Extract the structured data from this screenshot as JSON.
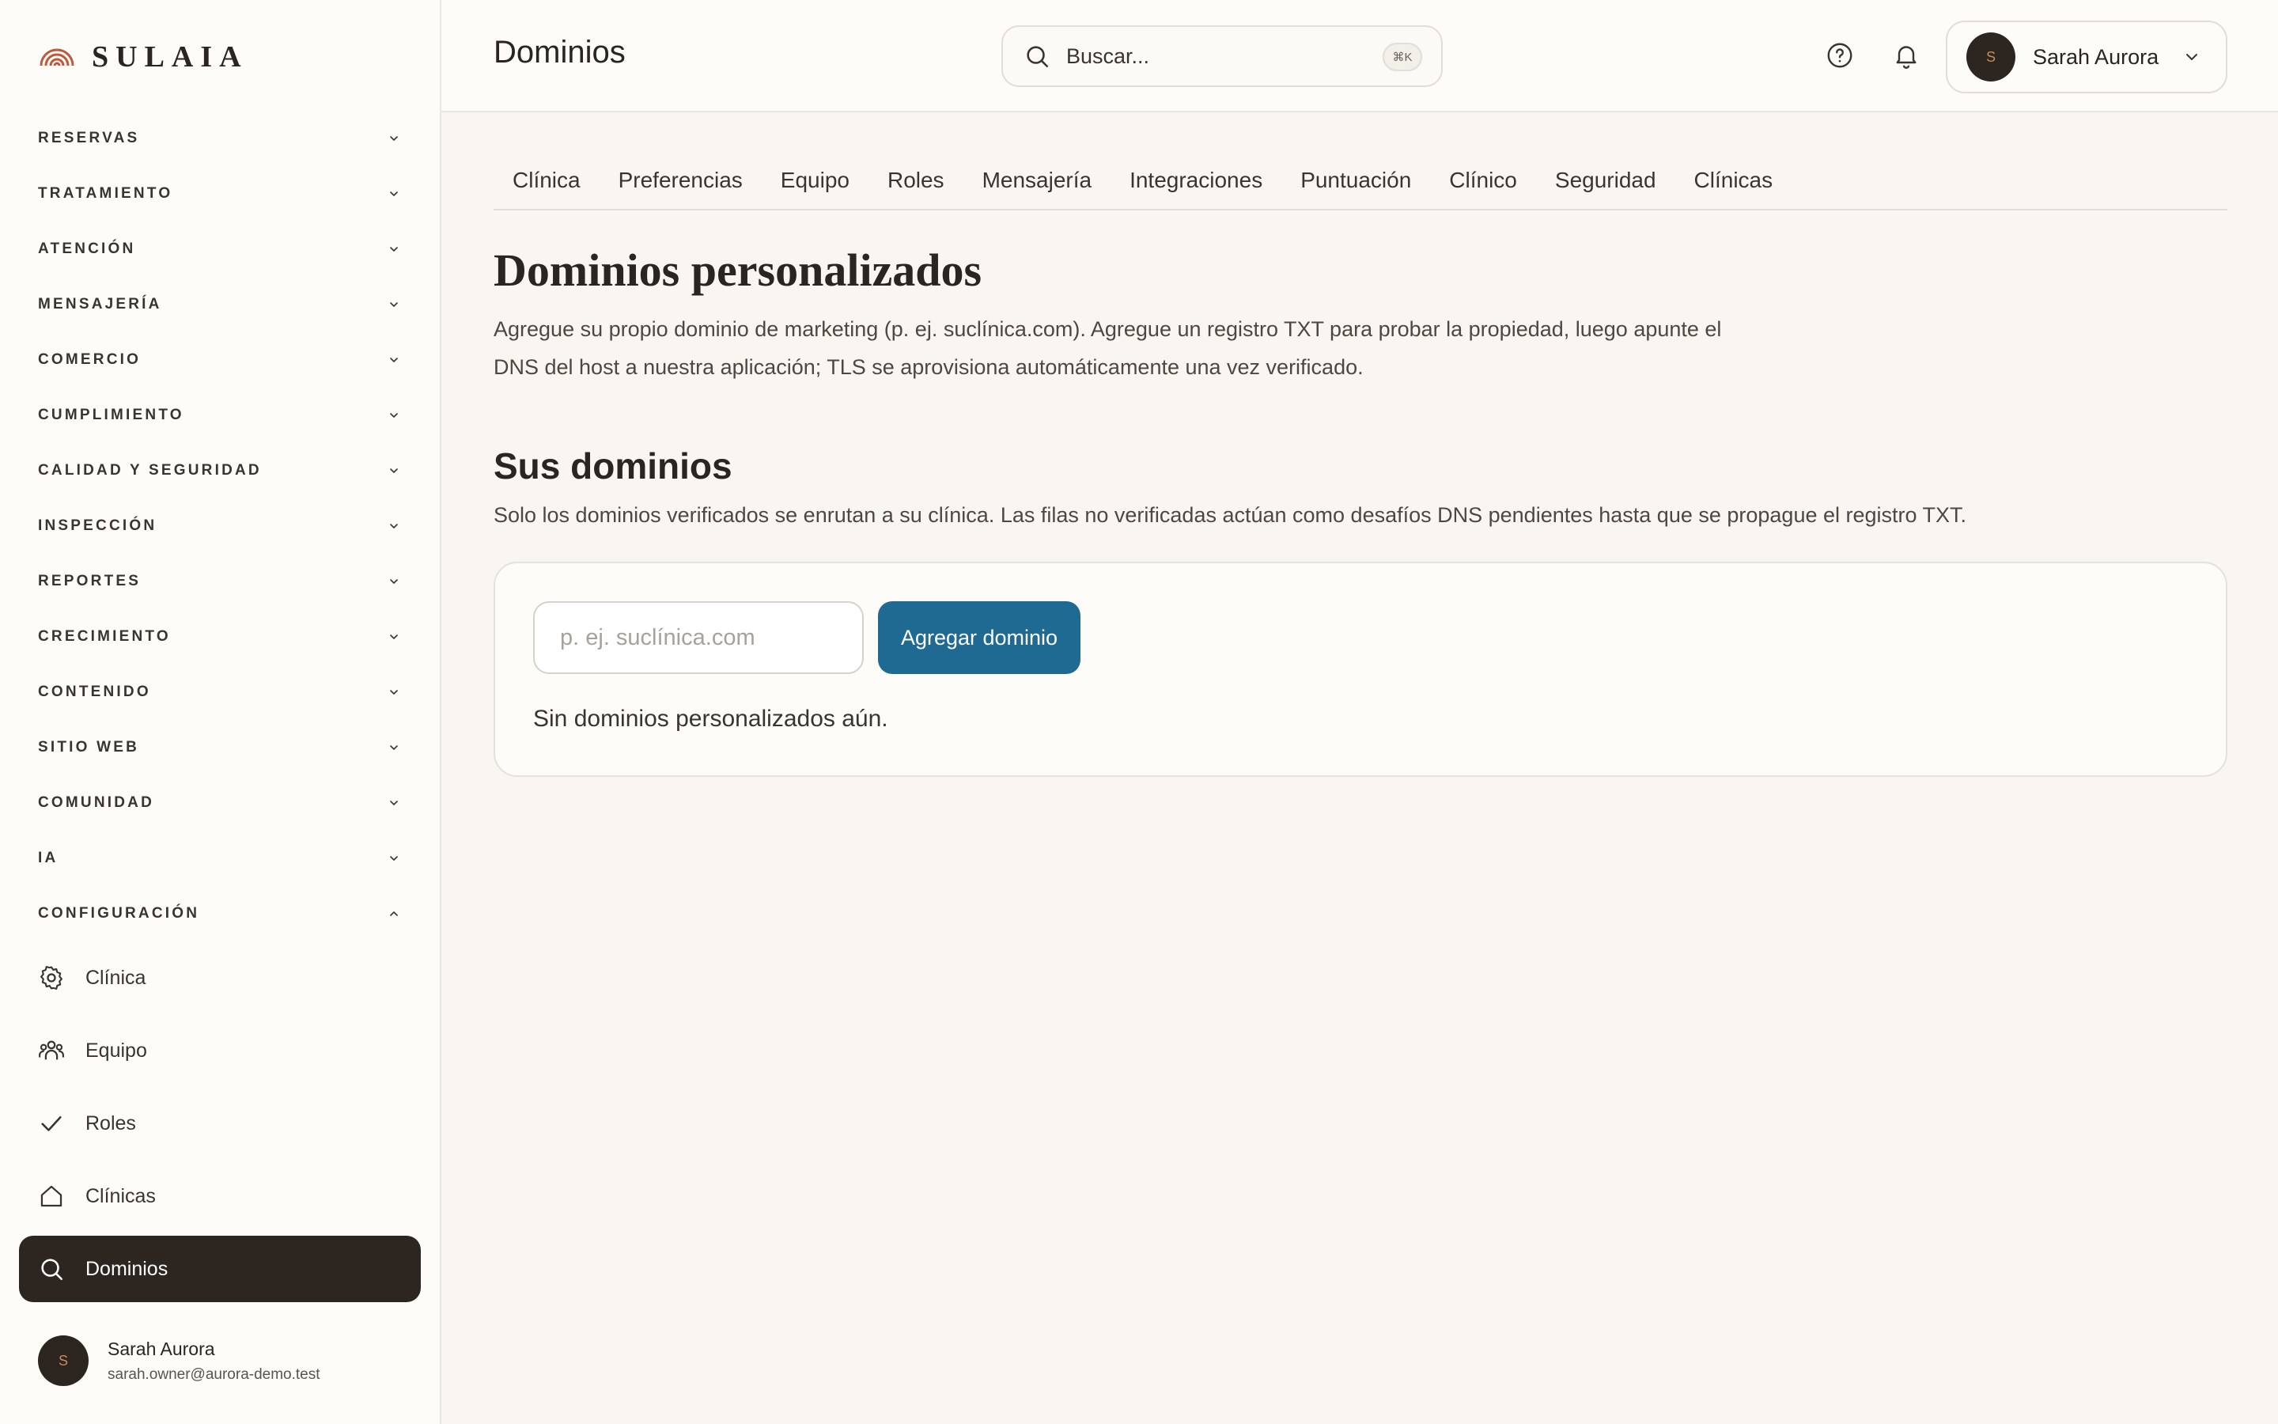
{
  "brand": {
    "name": "SULAIA",
    "logo_icon": "rainbow-arch-logo",
    "accent": "#c0593a"
  },
  "sidebar": {
    "sections": [
      {
        "label": "RESERVAS",
        "expanded": false
      },
      {
        "label": "TRATAMIENTO",
        "expanded": false
      },
      {
        "label": "ATENCIÓN",
        "expanded": false
      },
      {
        "label": "MENSAJERÍA",
        "expanded": false
      },
      {
        "label": "COMERCIO",
        "expanded": false
      },
      {
        "label": "CUMPLIMIENTO",
        "expanded": false
      },
      {
        "label": "CALIDAD Y SEGURIDAD",
        "expanded": false
      },
      {
        "label": "INSPECCIÓN",
        "expanded": false
      },
      {
        "label": "REPORTES",
        "expanded": false
      },
      {
        "label": "CRECIMIENTO",
        "expanded": false
      },
      {
        "label": "CONTENIDO",
        "expanded": false
      },
      {
        "label": "SITIO WEB",
        "expanded": false
      },
      {
        "label": "COMUNIDAD",
        "expanded": false
      },
      {
        "label": "IA",
        "expanded": false
      },
      {
        "label": "CONFIGURACIÓN",
        "expanded": true
      }
    ],
    "config_items": [
      {
        "label": "Clínica",
        "icon": "gear-icon"
      },
      {
        "label": "Equipo",
        "icon": "team-icon"
      },
      {
        "label": "Roles",
        "icon": "check-icon"
      },
      {
        "label": "Clínicas",
        "icon": "home-icon"
      },
      {
        "label": "Dominios",
        "icon": "search-icon",
        "active": true
      }
    ],
    "user": {
      "name": "Sarah Aurora",
      "email": "sarah.owner@aurora-demo.test",
      "initial": "S"
    }
  },
  "header": {
    "title": "Dominios",
    "search": {
      "placeholder": "Buscar...",
      "shortcut": "⌘K"
    },
    "help_icon": "help-circle-icon",
    "bell_icon": "bell-icon",
    "user": {
      "name": "Sarah Aurora",
      "initial": "S"
    }
  },
  "tabs": [
    "Clínica",
    "Preferencias",
    "Equipo",
    "Roles",
    "Mensajería",
    "Integraciones",
    "Puntuación",
    "Clínico",
    "Seguridad",
    "Clínicas"
  ],
  "main": {
    "heading": "Dominios personalizados",
    "description": "Agregue su propio dominio de marketing (p. ej. suclínica.com). Agregue un registro TXT para probar la propiedad, luego apunte el DNS del host a nuestra aplicación; TLS se aprovisiona automáticamente una vez verificado.",
    "subheading": "Sus dominios",
    "subdescription": "Solo los dominios verificados se enrutan a su clínica. Las filas no verificadas actúan como desafíos DNS pendientes hasta que se propague el registro TXT.",
    "input_placeholder": "p. ej. suclínica.com",
    "input_value": "",
    "add_button": "Agregar dominio",
    "empty_state": "Sin dominios personalizados aún."
  },
  "colors": {
    "primary_button": "#1f6a92",
    "active_nav": "#2c2520",
    "background": "#f9f6f1"
  }
}
